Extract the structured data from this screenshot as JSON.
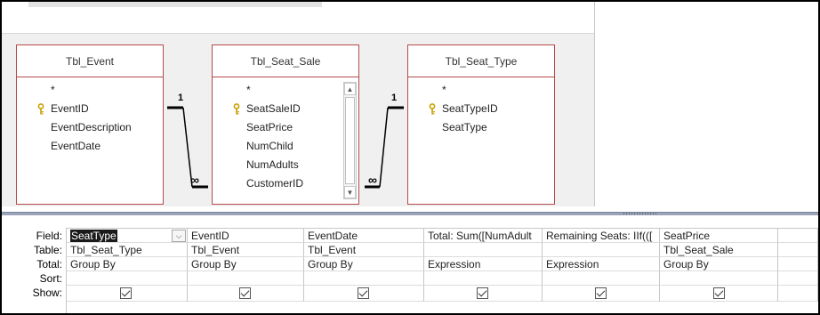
{
  "tables": [
    {
      "title": "Tbl_Event",
      "fields": [
        {
          "name": "*",
          "key": false
        },
        {
          "name": "EventID",
          "key": true
        },
        {
          "name": "EventDescription",
          "key": false
        },
        {
          "name": "EventDate",
          "key": false
        }
      ]
    },
    {
      "title": "Tbl_Seat_Sale",
      "fields": [
        {
          "name": "*",
          "key": false
        },
        {
          "name": "SeatSaleID",
          "key": true
        },
        {
          "name": "SeatPrice",
          "key": false
        },
        {
          "name": "NumChild",
          "key": false
        },
        {
          "name": "NumAdults",
          "key": false
        },
        {
          "name": "CustomerID",
          "key": false
        }
      ]
    },
    {
      "title": "Tbl_Seat_Type",
      "fields": [
        {
          "name": "*",
          "key": false
        },
        {
          "name": "SeatTypeID",
          "key": true
        },
        {
          "name": "SeatType",
          "key": false
        }
      ]
    }
  ],
  "relationships": [
    {
      "one_label": "1",
      "many_label": "∞"
    },
    {
      "one_label": "1",
      "many_label": "∞"
    }
  ],
  "grid": {
    "row_labels": {
      "field": "Field:",
      "table": "Table:",
      "total": "Total:",
      "sort": "Sort:",
      "show": "Show:"
    },
    "columns": [
      {
        "field": "SeatType",
        "table": "Tbl_Seat_Type",
        "total": "Group By",
        "sort": "",
        "show": true,
        "selected": true
      },
      {
        "field": "EventID",
        "table": "Tbl_Event",
        "total": "Group By",
        "sort": "",
        "show": true
      },
      {
        "field": "EventDate",
        "table": "Tbl_Event",
        "total": "Group By",
        "sort": "",
        "show": true
      },
      {
        "field": "Total: Sum([NumAdult",
        "table": "",
        "total": "Expression",
        "sort": "",
        "show": true
      },
      {
        "field": "Remaining Seats: IIf(([",
        "table": "",
        "total": "Expression",
        "sort": "",
        "show": true
      },
      {
        "field": "SeatPrice",
        "table": "Tbl_Seat_Sale",
        "total": "Group By",
        "sort": "",
        "show": true
      },
      {
        "field": "",
        "table": "",
        "total": "",
        "sort": "",
        "show": false
      }
    ]
  },
  "colors": {
    "table_border": "#b54a4a",
    "splitter": "#9aa3b8",
    "design_bg": "#f0f0f0"
  }
}
